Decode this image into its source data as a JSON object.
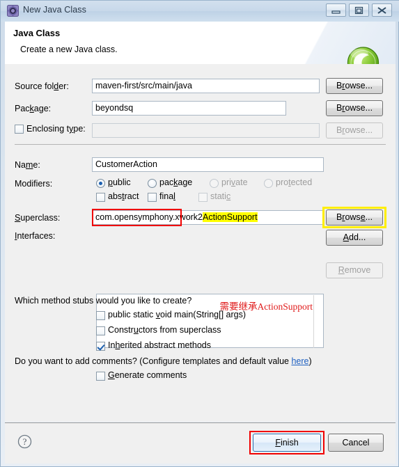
{
  "window": {
    "title": "New Java Class",
    "icon": "eclipse-new-class-icon",
    "controls": {
      "minimize": "minimize-icon",
      "maximize": "maximize-icon",
      "close": "close-icon"
    }
  },
  "header": {
    "title": "Java Class",
    "subtitle": "Create a new Java class.",
    "logo": "green-c-wizard-icon"
  },
  "form": {
    "source_folder": {
      "label": "Source folder:",
      "label_mnemonic_pre": "Source fol",
      "label_mnemonic": "d",
      "label_mnemonic_post": "er:",
      "value": "maven-first/src/main/java",
      "browse": "Browse..."
    },
    "package": {
      "label": "Package:",
      "label_mnemonic_pre": "Pac",
      "label_mnemonic": "k",
      "label_mnemonic_post": "age:",
      "value": "beyondsq",
      "browse": "Browse..."
    },
    "enclosing_type": {
      "label": "Enclosing type:",
      "label_mnemonic_pre": "Enclosing t",
      "label_mnemonic": "y",
      "label_mnemonic_post": "pe:",
      "checked": false,
      "value": "",
      "browse": "Browse...",
      "enabled": false
    },
    "name": {
      "label": "Name:",
      "label_mnemonic_pre": "Na",
      "label_mnemonic": "m",
      "label_mnemonic_post": "e:",
      "value": "CustomerAction"
    },
    "modifiers": {
      "label": "Modifiers:",
      "access": [
        {
          "label": "public",
          "pre": "",
          "mnemonic": "p",
          "post": "ublic",
          "selected": true,
          "enabled": true
        },
        {
          "label": "package",
          "pre": "pac",
          "mnemonic": "k",
          "post": "age",
          "selected": false,
          "enabled": true
        },
        {
          "label": "private",
          "pre": "pri",
          "mnemonic": "v",
          "post": "ate",
          "selected": false,
          "enabled": false
        },
        {
          "label": "protected",
          "pre": "pro",
          "mnemonic": "t",
          "post": "ected",
          "selected": false,
          "enabled": false
        }
      ],
      "flags": [
        {
          "label": "abstract",
          "pre": "abs",
          "mnemonic": "t",
          "post": "ract",
          "checked": false,
          "enabled": true
        },
        {
          "label": "final",
          "pre": "fina",
          "mnemonic": "l",
          "post": "",
          "checked": false,
          "enabled": true
        },
        {
          "label": "static",
          "pre": "stati",
          "mnemonic": "c",
          "post": "",
          "checked": false,
          "enabled": false
        }
      ]
    },
    "superclass": {
      "label": "Superclass:",
      "label_mnemonic_pre": "",
      "label_mnemonic": "S",
      "label_mnemonic_post": "uperclass:",
      "value_prefix": "com.opensymphony.xwork2",
      "value_highlighted": "ActionSupport",
      "value_full": "com.opensymphony.xwork2.ActionSupport",
      "browse": "Browse...",
      "browse_highlight_color": "#ffee00",
      "value_highlight_color": "#ffff00",
      "field_outline_color": "#f00000"
    },
    "interfaces": {
      "label": "Interfaces:",
      "label_mnemonic_pre": "",
      "label_mnemonic": "I",
      "label_mnemonic_post": "nterfaces:",
      "items": [],
      "annotation": "需要继承ActionSupport",
      "annotation_color": "#e01b1b",
      "add": "Add...",
      "remove": "Remove",
      "remove_enabled": false
    },
    "stubs": {
      "question": "Which method stubs would you like to create?",
      "options": [
        {
          "label": "public static void main(String[] args)",
          "pre": "public static ",
          "mnemonic": "v",
          "post": "oid main(String[] args)",
          "checked": false
        },
        {
          "label": "Constructors from superclass",
          "pre": "Constr",
          "mnemonic": "u",
          "post": "ctors from superclass",
          "checked": false
        },
        {
          "label": "Inherited abstract methods",
          "pre": "In",
          "mnemonic": "h",
          "post": "erited abstract methods",
          "checked": true
        }
      ]
    },
    "comments": {
      "question_pre": "Do you want to add comments? (Configure templates and default value ",
      "link": "here",
      "question_post": ")",
      "option": {
        "label": "Generate comments",
        "pre": "",
        "mnemonic": "G",
        "post": "enerate comments",
        "checked": false
      }
    }
  },
  "footer": {
    "help": "help-icon",
    "finish": "Finish",
    "finish_mnemonic_pre": "",
    "finish_mnemonic": "F",
    "finish_mnemonic_post": "inish",
    "finish_highlight_color": "#f00000",
    "cancel": "Cancel",
    "finish_default": true
  }
}
